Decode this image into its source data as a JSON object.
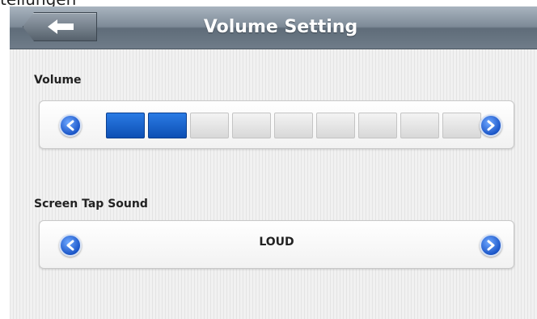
{
  "partial_text": "tellungen",
  "header": {
    "title": "Volume Setting",
    "back_icon": "back-arrow-icon"
  },
  "volume": {
    "label": "Volume",
    "level": 2,
    "max_level": 9,
    "active_color": "#1a63cc",
    "inactive_color": "#e2e2e2",
    "decrease_icon": "chevron-left-icon",
    "increase_icon": "chevron-right-icon"
  },
  "tap_sound": {
    "label": "Screen Tap Sound",
    "value": "LOUD",
    "previous_icon": "chevron-left-icon",
    "next_icon": "chevron-right-icon"
  },
  "colors": {
    "header_bar": "#7d8a97",
    "button_blue": "#1b56c8"
  }
}
